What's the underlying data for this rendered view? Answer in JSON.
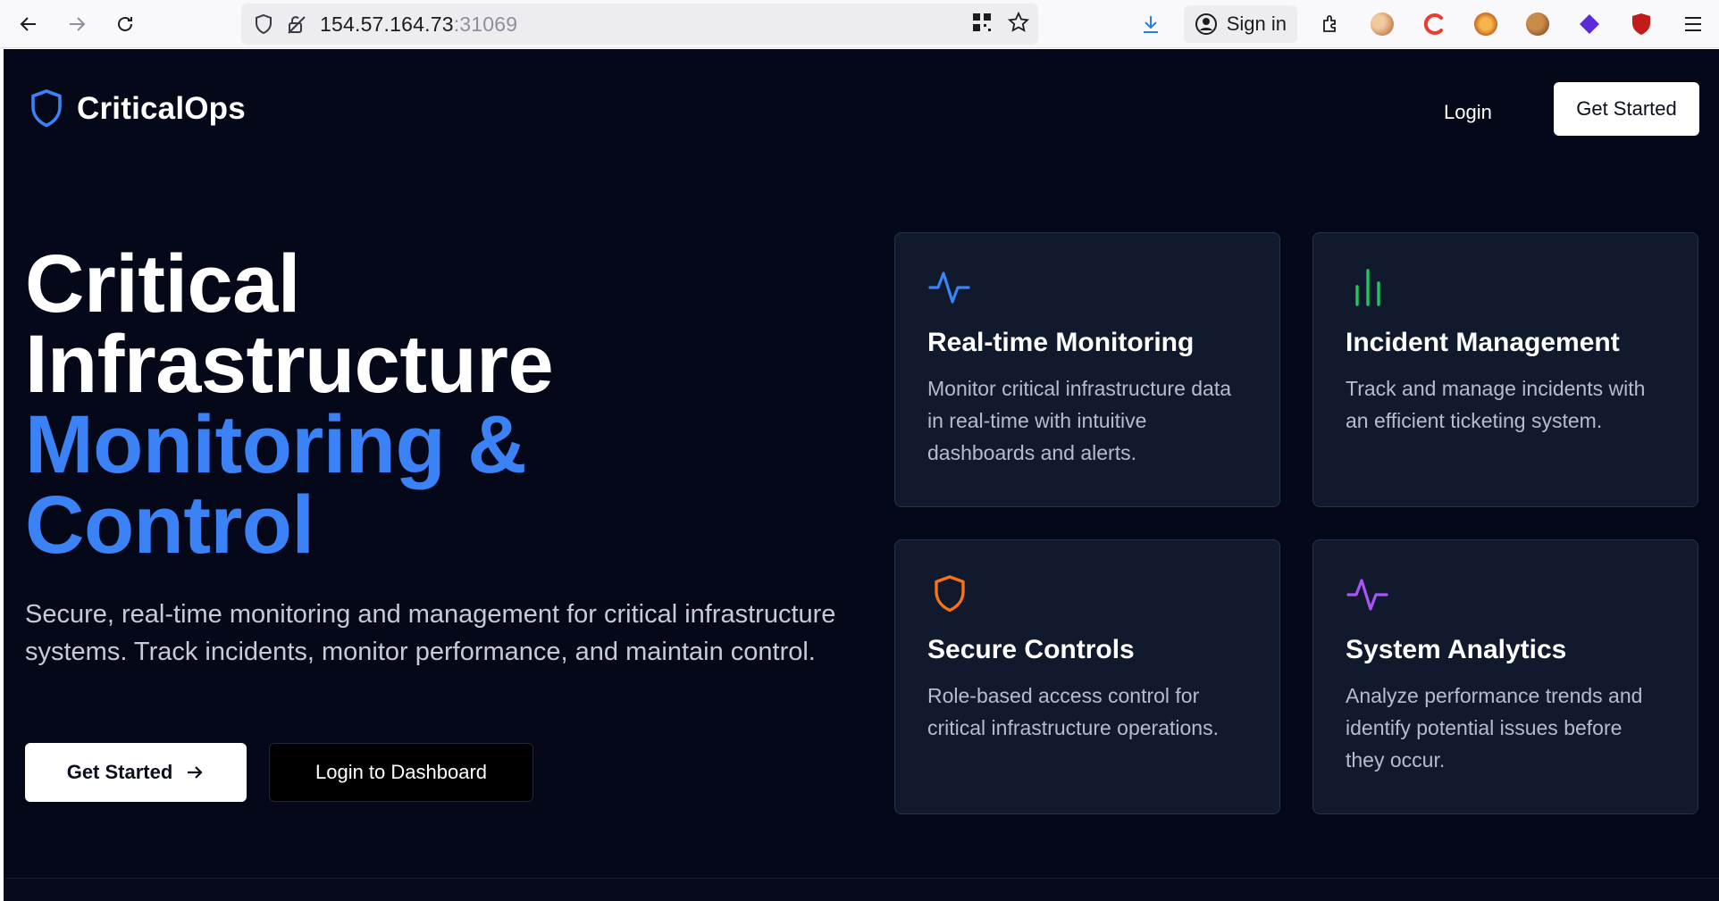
{
  "browser": {
    "url_host": "154.57.164.73",
    "url_port": ":31069",
    "sign_in_label": "Sign in"
  },
  "nav": {
    "brand": "CriticalOps",
    "login": "Login",
    "get_started": "Get Started"
  },
  "hero": {
    "title_line1": "Critical",
    "title_line2": "Infrastructure",
    "title_line3": "Monitoring &",
    "title_line4": "Control",
    "description": "Secure, real-time monitoring and management for critical infrastructure systems. Track incidents, monitor performance, and maintain control.",
    "primary_button": "Get Started",
    "secondary_button": "Login to Dashboard"
  },
  "features": [
    {
      "title": "Real-time Monitoring",
      "description": "Monitor critical infrastructure data in real-time with intuitive dashboards and alerts.",
      "icon": "activity-icon",
      "color": "#3b82f6"
    },
    {
      "title": "Incident Management",
      "description": "Track and manage incidents with an efficient ticketing system.",
      "icon": "bar-chart-icon",
      "color": "#22c55e"
    },
    {
      "title": "Secure Controls",
      "description": "Role-based access control for critical infrastructure operations.",
      "icon": "shield-icon",
      "color": "#f97316"
    },
    {
      "title": "System Analytics",
      "description": "Analyze performance trends and identify potential issues before they occur.",
      "icon": "activity-icon",
      "color": "#a855f7"
    }
  ],
  "colors": {
    "background": "#040818",
    "accent": "#3b82f6",
    "card": "#111a2d"
  }
}
